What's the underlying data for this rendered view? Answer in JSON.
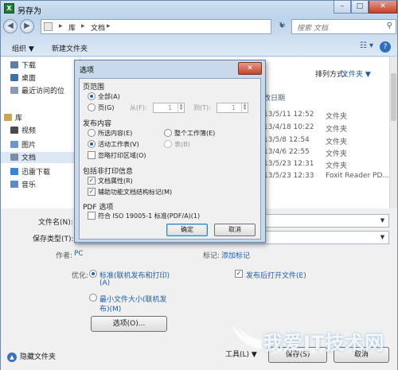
{
  "window": {
    "title": "另存为",
    "app_icon": "excel-icon"
  },
  "address": {
    "crumbs": [
      "库",
      "文档"
    ],
    "search_placeholder": "搜索 文档"
  },
  "toolbar": {
    "organize": "组织 ▼",
    "new_folder": "新建文件夹"
  },
  "nav": {
    "items": [
      {
        "label": "下载",
        "icon": "download-folder-icon"
      },
      {
        "label": "桌面",
        "icon": "desktop-icon"
      },
      {
        "label": "最近访问的位",
        "icon": "recent-places-icon"
      },
      {
        "label": "库",
        "icon": "library-icon"
      },
      {
        "label": "视频",
        "icon": "video-library-icon"
      },
      {
        "label": "图片",
        "icon": "pictures-library-icon"
      },
      {
        "label": "文档",
        "icon": "documents-library-icon"
      },
      {
        "label": "迅雷下载",
        "icon": "xunlei-download-icon"
      },
      {
        "label": "音乐",
        "icon": "music-library-icon"
      }
    ]
  },
  "filelist": {
    "sort_label": "排列方式:",
    "sort_value": "文件夹 ▼",
    "col_date": "改日期",
    "rows": [
      {
        "date": "13/5/11 12:52",
        "type": "文件夹"
      },
      {
        "date": "13/4/18 10:22",
        "type": "文件夹"
      },
      {
        "date": "13/5/8 12:54",
        "type": "文件夹"
      },
      {
        "date": "13/4/6 22:55",
        "type": "文件夹"
      },
      {
        "date": "13/5/23 12:31",
        "type": "文件夹"
      },
      {
        "date": "13/5/23 12:33",
        "type": "Foxit Reader PD..."
      }
    ]
  },
  "form": {
    "filename_label": "文件名(N):",
    "filetype_label": "保存类型(T):",
    "author_label": "作者:",
    "author_value": "PC",
    "tags_label": "标记:",
    "tags_value": "添加标记",
    "optimize_label": "优化:",
    "opt_standard": "标准(联机发布和打印)",
    "opt_standard_2": "(A)",
    "opt_min": "最小文件大小(联机发",
    "opt_min_2": "布)(M)",
    "open_after": "发布后打开文件(E)",
    "options_button": "选项(O)...",
    "hide_folders": "隐藏文件夹",
    "tools": "工具(L)",
    "save": "保存(S)",
    "cancel": "取消"
  },
  "dialog": {
    "title": "选项",
    "page_range": "页范围",
    "all": "全部(A)",
    "pages": "页(G)",
    "from": "从(F):",
    "from_val": "1",
    "to": "到(T):",
    "to_val": "1",
    "publish_content": "发布内容",
    "selection": "所选内容(E)",
    "whole_workbook": "整个工作簿(E)",
    "active_sheet": "活动工作表(V)",
    "table": "表(B)",
    "ignore_print_area": "忽略打印区域(O)",
    "include_nonprint": "包括非打印信息",
    "doc_properties": "文档属性(R)",
    "doc_structure_tags": "辅助功能文档结构标记(M)",
    "pdf_options": "PDF 选项",
    "iso_compliant": "符合 ISO 19005-1 标准(PDF/A)(1)",
    "ok": "确定",
    "cancel": "取消"
  },
  "watermark": {
    "text": "我爱IT技术网",
    "sub": "WWW.52ITJS.COM"
  }
}
